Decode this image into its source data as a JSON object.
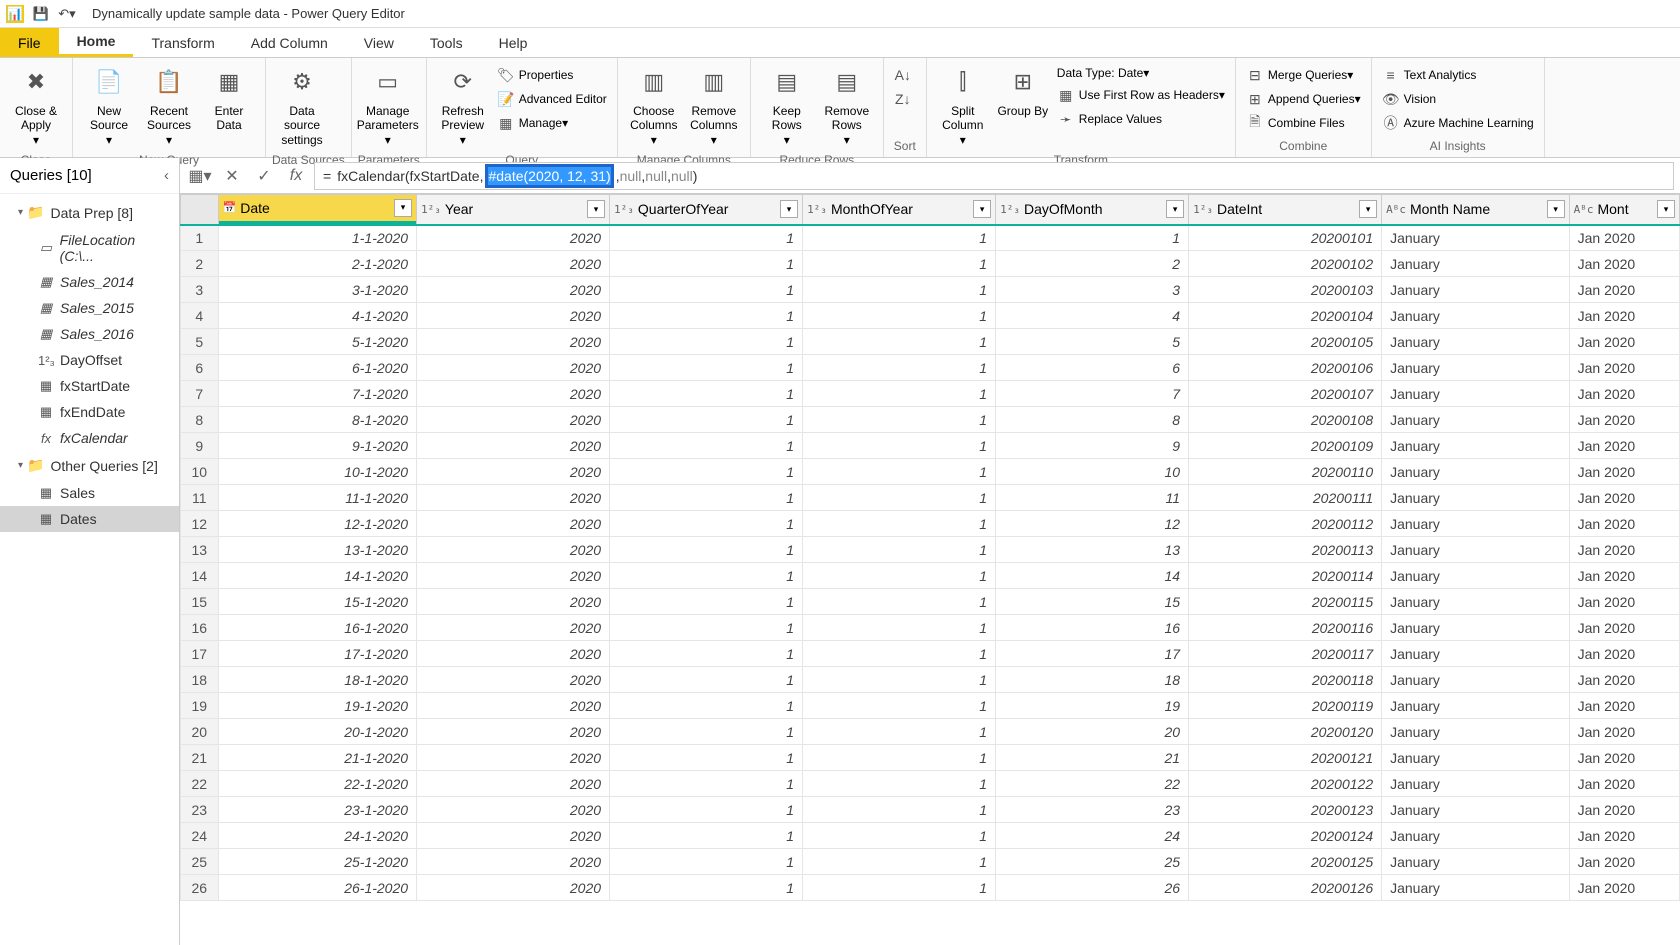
{
  "title": "Dynamically update sample data - Power Query Editor",
  "menutabs": [
    "File",
    "Home",
    "Transform",
    "Add Column",
    "View",
    "Tools",
    "Help"
  ],
  "active_tab": "Home",
  "ribbon": {
    "close": {
      "close_apply": "Close &\nApply",
      "group": "Close"
    },
    "newquery": {
      "new_source": "New\nSource",
      "recent_sources": "Recent\nSources",
      "enter_data": "Enter\nData",
      "group": "New Query"
    },
    "datasources": {
      "data_source_settings": "Data source\nsettings",
      "group": "Data Sources"
    },
    "parameters": {
      "manage_parameters": "Manage\nParameters",
      "group": "Parameters"
    },
    "query": {
      "refresh": "Refresh\nPreview",
      "properties": "Properties",
      "advanced_editor": "Advanced Editor",
      "manage": "Manage",
      "group": "Query"
    },
    "managecols": {
      "choose_columns": "Choose\nColumns",
      "remove_columns": "Remove\nColumns",
      "group": "Manage Columns"
    },
    "reducerows": {
      "keep_rows": "Keep\nRows",
      "remove_rows": "Remove\nRows",
      "group": "Reduce Rows"
    },
    "sort": {
      "group": "Sort"
    },
    "transform": {
      "split_column": "Split\nColumn",
      "group_by": "Group\nBy",
      "data_type": "Data Type: Date",
      "first_row": "Use First Row as Headers",
      "replace_values": "Replace Values",
      "group": "Transform"
    },
    "combine": {
      "merge": "Merge Queries",
      "append": "Append Queries",
      "combine_files": "Combine Files",
      "group": "Combine"
    },
    "ai": {
      "text_analytics": "Text Analytics",
      "vision": "Vision",
      "azure_ml": "Azure Machine Learning",
      "group": "AI Insights"
    }
  },
  "queries": {
    "header": "Queries [10]",
    "groups": [
      {
        "name": "Data Prep [8]",
        "items": [
          {
            "label": "FileLocation (C:\\...",
            "icon": "param",
            "italic": true
          },
          {
            "label": "Sales_2014",
            "icon": "table",
            "italic": true
          },
          {
            "label": "Sales_2015",
            "icon": "table",
            "italic": true
          },
          {
            "label": "Sales_2016",
            "icon": "table",
            "italic": true
          },
          {
            "label": "DayOffset",
            "icon": "num",
            "italic": false
          },
          {
            "label": "fxStartDate",
            "icon": "table",
            "italic": false
          },
          {
            "label": "fxEndDate",
            "icon": "table",
            "italic": false
          },
          {
            "label": "fxCalendar",
            "icon": "fx",
            "italic": true
          }
        ]
      },
      {
        "name": "Other Queries [2]",
        "items": [
          {
            "label": "Sales",
            "icon": "table",
            "italic": false
          },
          {
            "label": "Dates",
            "icon": "table",
            "italic": false,
            "selected": true
          }
        ]
      }
    ]
  },
  "formula": {
    "prefix": "fxCalendar(fxStartDate, ",
    "highlight": "#date(2020, 12, 31)",
    "suffix1": ", ",
    "null1": "null",
    "suffix2": ", ",
    "null2": "null",
    "suffix3": ", ",
    "null3": "null",
    "suffix4": ")"
  },
  "columns": [
    {
      "name": "Date",
      "type": "date",
      "class": "col-date-c",
      "head": "col-date"
    },
    {
      "name": "Year",
      "type": "num",
      "class": "col-year-c"
    },
    {
      "name": "QuarterOfYear",
      "type": "num",
      "class": "col-qoy-c"
    },
    {
      "name": "MonthOfYear",
      "type": "num",
      "class": "col-moy-c"
    },
    {
      "name": "DayOfMonth",
      "type": "num",
      "class": "col-dom-c"
    },
    {
      "name": "DateInt",
      "type": "num",
      "class": "col-di-c"
    },
    {
      "name": "Month Name",
      "type": "text",
      "class": "col-mn-c"
    },
    {
      "name": "Mont",
      "type": "text",
      "class": "col-mnt-c"
    }
  ],
  "type_icons": {
    "date": "📅",
    "num": "1²₃",
    "text": "Aᴮc"
  },
  "rows": [
    {
      "n": 1,
      "Date": "1-1-2020",
      "Year": "2020",
      "QuarterOfYear": "1",
      "MonthOfYear": "1",
      "DayOfMonth": "1",
      "DateInt": "20200101",
      "Month Name": "January",
      "Mont": "Jan 2020"
    },
    {
      "n": 2,
      "Date": "2-1-2020",
      "Year": "2020",
      "QuarterOfYear": "1",
      "MonthOfYear": "1",
      "DayOfMonth": "2",
      "DateInt": "20200102",
      "Month Name": "January",
      "Mont": "Jan 2020"
    },
    {
      "n": 3,
      "Date": "3-1-2020",
      "Year": "2020",
      "QuarterOfYear": "1",
      "MonthOfYear": "1",
      "DayOfMonth": "3",
      "DateInt": "20200103",
      "Month Name": "January",
      "Mont": "Jan 2020"
    },
    {
      "n": 4,
      "Date": "4-1-2020",
      "Year": "2020",
      "QuarterOfYear": "1",
      "MonthOfYear": "1",
      "DayOfMonth": "4",
      "DateInt": "20200104",
      "Month Name": "January",
      "Mont": "Jan 2020"
    },
    {
      "n": 5,
      "Date": "5-1-2020",
      "Year": "2020",
      "QuarterOfYear": "1",
      "MonthOfYear": "1",
      "DayOfMonth": "5",
      "DateInt": "20200105",
      "Month Name": "January",
      "Mont": "Jan 2020"
    },
    {
      "n": 6,
      "Date": "6-1-2020",
      "Year": "2020",
      "QuarterOfYear": "1",
      "MonthOfYear": "1",
      "DayOfMonth": "6",
      "DateInt": "20200106",
      "Month Name": "January",
      "Mont": "Jan 2020"
    },
    {
      "n": 7,
      "Date": "7-1-2020",
      "Year": "2020",
      "QuarterOfYear": "1",
      "MonthOfYear": "1",
      "DayOfMonth": "7",
      "DateInt": "20200107",
      "Month Name": "January",
      "Mont": "Jan 2020"
    },
    {
      "n": 8,
      "Date": "8-1-2020",
      "Year": "2020",
      "QuarterOfYear": "1",
      "MonthOfYear": "1",
      "DayOfMonth": "8",
      "DateInt": "20200108",
      "Month Name": "January",
      "Mont": "Jan 2020"
    },
    {
      "n": 9,
      "Date": "9-1-2020",
      "Year": "2020",
      "QuarterOfYear": "1",
      "MonthOfYear": "1",
      "DayOfMonth": "9",
      "DateInt": "20200109",
      "Month Name": "January",
      "Mont": "Jan 2020"
    },
    {
      "n": 10,
      "Date": "10-1-2020",
      "Year": "2020",
      "QuarterOfYear": "1",
      "MonthOfYear": "1",
      "DayOfMonth": "10",
      "DateInt": "20200110",
      "Month Name": "January",
      "Mont": "Jan 2020"
    },
    {
      "n": 11,
      "Date": "11-1-2020",
      "Year": "2020",
      "QuarterOfYear": "1",
      "MonthOfYear": "1",
      "DayOfMonth": "11",
      "DateInt": "20200111",
      "Month Name": "January",
      "Mont": "Jan 2020"
    },
    {
      "n": 12,
      "Date": "12-1-2020",
      "Year": "2020",
      "QuarterOfYear": "1",
      "MonthOfYear": "1",
      "DayOfMonth": "12",
      "DateInt": "20200112",
      "Month Name": "January",
      "Mont": "Jan 2020"
    },
    {
      "n": 13,
      "Date": "13-1-2020",
      "Year": "2020",
      "QuarterOfYear": "1",
      "MonthOfYear": "1",
      "DayOfMonth": "13",
      "DateInt": "20200113",
      "Month Name": "January",
      "Mont": "Jan 2020"
    },
    {
      "n": 14,
      "Date": "14-1-2020",
      "Year": "2020",
      "QuarterOfYear": "1",
      "MonthOfYear": "1",
      "DayOfMonth": "14",
      "DateInt": "20200114",
      "Month Name": "January",
      "Mont": "Jan 2020"
    },
    {
      "n": 15,
      "Date": "15-1-2020",
      "Year": "2020",
      "QuarterOfYear": "1",
      "MonthOfYear": "1",
      "DayOfMonth": "15",
      "DateInt": "20200115",
      "Month Name": "January",
      "Mont": "Jan 2020"
    },
    {
      "n": 16,
      "Date": "16-1-2020",
      "Year": "2020",
      "QuarterOfYear": "1",
      "MonthOfYear": "1",
      "DayOfMonth": "16",
      "DateInt": "20200116",
      "Month Name": "January",
      "Mont": "Jan 2020"
    },
    {
      "n": 17,
      "Date": "17-1-2020",
      "Year": "2020",
      "QuarterOfYear": "1",
      "MonthOfYear": "1",
      "DayOfMonth": "17",
      "DateInt": "20200117",
      "Month Name": "January",
      "Mont": "Jan 2020"
    },
    {
      "n": 18,
      "Date": "18-1-2020",
      "Year": "2020",
      "QuarterOfYear": "1",
      "MonthOfYear": "1",
      "DayOfMonth": "18",
      "DateInt": "20200118",
      "Month Name": "January",
      "Mont": "Jan 2020"
    },
    {
      "n": 19,
      "Date": "19-1-2020",
      "Year": "2020",
      "QuarterOfYear": "1",
      "MonthOfYear": "1",
      "DayOfMonth": "19",
      "DateInt": "20200119",
      "Month Name": "January",
      "Mont": "Jan 2020"
    },
    {
      "n": 20,
      "Date": "20-1-2020",
      "Year": "2020",
      "QuarterOfYear": "1",
      "MonthOfYear": "1",
      "DayOfMonth": "20",
      "DateInt": "20200120",
      "Month Name": "January",
      "Mont": "Jan 2020"
    },
    {
      "n": 21,
      "Date": "21-1-2020",
      "Year": "2020",
      "QuarterOfYear": "1",
      "MonthOfYear": "1",
      "DayOfMonth": "21",
      "DateInt": "20200121",
      "Month Name": "January",
      "Mont": "Jan 2020"
    },
    {
      "n": 22,
      "Date": "22-1-2020",
      "Year": "2020",
      "QuarterOfYear": "1",
      "MonthOfYear": "1",
      "DayOfMonth": "22",
      "DateInt": "20200122",
      "Month Name": "January",
      "Mont": "Jan 2020"
    },
    {
      "n": 23,
      "Date": "23-1-2020",
      "Year": "2020",
      "QuarterOfYear": "1",
      "MonthOfYear": "1",
      "DayOfMonth": "23",
      "DateInt": "20200123",
      "Month Name": "January",
      "Mont": "Jan 2020"
    },
    {
      "n": 24,
      "Date": "24-1-2020",
      "Year": "2020",
      "QuarterOfYear": "1",
      "MonthOfYear": "1",
      "DayOfMonth": "24",
      "DateInt": "20200124",
      "Month Name": "January",
      "Mont": "Jan 2020"
    },
    {
      "n": 25,
      "Date": "25-1-2020",
      "Year": "2020",
      "QuarterOfYear": "1",
      "MonthOfYear": "1",
      "DayOfMonth": "25",
      "DateInt": "20200125",
      "Month Name": "January",
      "Mont": "Jan 2020"
    },
    {
      "n": 26,
      "Date": "26-1-2020",
      "Year": "2020",
      "QuarterOfYear": "1",
      "MonthOfYear": "1",
      "DayOfMonth": "26",
      "DateInt": "20200126",
      "Month Name": "January",
      "Mont": "Jan 2020"
    }
  ]
}
